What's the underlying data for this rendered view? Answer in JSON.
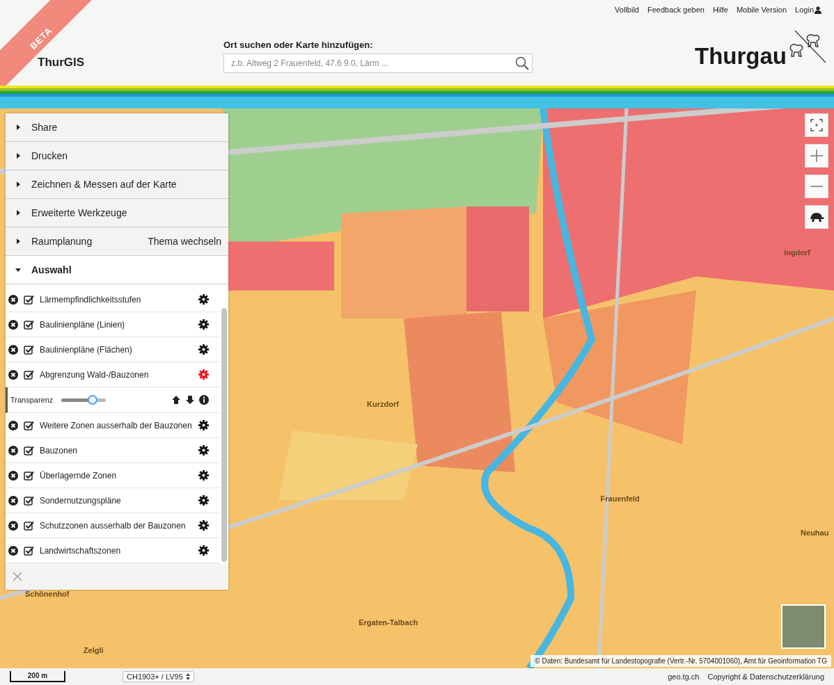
{
  "ribbon": "BETA",
  "app_title": "ThurGIS",
  "top_links": [
    {
      "label": "Vollbild"
    },
    {
      "label": "Feedback geben"
    },
    {
      "label": "Hilfe"
    },
    {
      "label": "Mobile Version"
    },
    {
      "label": "Login"
    }
  ],
  "search": {
    "label": "Ort suchen oder Karte hinzufügen:",
    "placeholder": "z.b. Altweg 2 Frauenfeld, 47.6 9.0, Lärm ..."
  },
  "logo_text": "Thurgau",
  "menu": [
    {
      "label": "Share",
      "expanded": false
    },
    {
      "label": "Drucken",
      "expanded": false
    },
    {
      "label": "Zeichnen & Messen auf der Karte",
      "expanded": false
    },
    {
      "label": "Erweiterte Werkzeuge",
      "expanded": false
    },
    {
      "label": "Raumplanung",
      "expanded": false,
      "action": "Thema wechseln"
    },
    {
      "label": "Auswahl",
      "expanded": true
    }
  ],
  "layers": [
    {
      "name": "Lärmempfindlichkeitsstufen",
      "checked": true,
      "expanded": false
    },
    {
      "name": "Baulinienpläne (Linien)",
      "checked": true,
      "expanded": false
    },
    {
      "name": "Baulinienpläne (Flächen)",
      "checked": true,
      "expanded": false
    },
    {
      "name": "Abgrenzung Wald-/Bauzonen",
      "checked": true,
      "expanded": true,
      "transparency_label": "Transparenz",
      "level": 0.7
    },
    {
      "name": "Weitere Zonen ausserhalb der Bauzonen",
      "checked": true,
      "expanded": false
    },
    {
      "name": "Bauzonen",
      "checked": true,
      "expanded": false
    },
    {
      "name": "Überlagernde Zonen",
      "checked": true,
      "expanded": false
    },
    {
      "name": "Sondernutzungspläne",
      "checked": true,
      "expanded": false
    },
    {
      "name": "Schutzzonen ausserhalb der Bauzonen",
      "checked": true,
      "expanded": false
    },
    {
      "name": "Landwirtschaftszonen",
      "checked": true,
      "expanded": false
    }
  ],
  "map_labels": [
    "Kurzdorf",
    "Frauenfeld",
    "Schönenhof",
    "Ergaten-Talbach",
    "Zelgli",
    "Neuhau",
    "ingdorf"
  ],
  "attribution": "©  Daten: Bundesamt für Landestopografie (Vertr.-Nr. 5704001060), Amt für Geoinformation TG",
  "scale": "200 m",
  "projection": "CH1903+ / LV95",
  "footer_links": [
    "geo.tg.ch",
    "Copyright & Datenschutzerklärung"
  ]
}
